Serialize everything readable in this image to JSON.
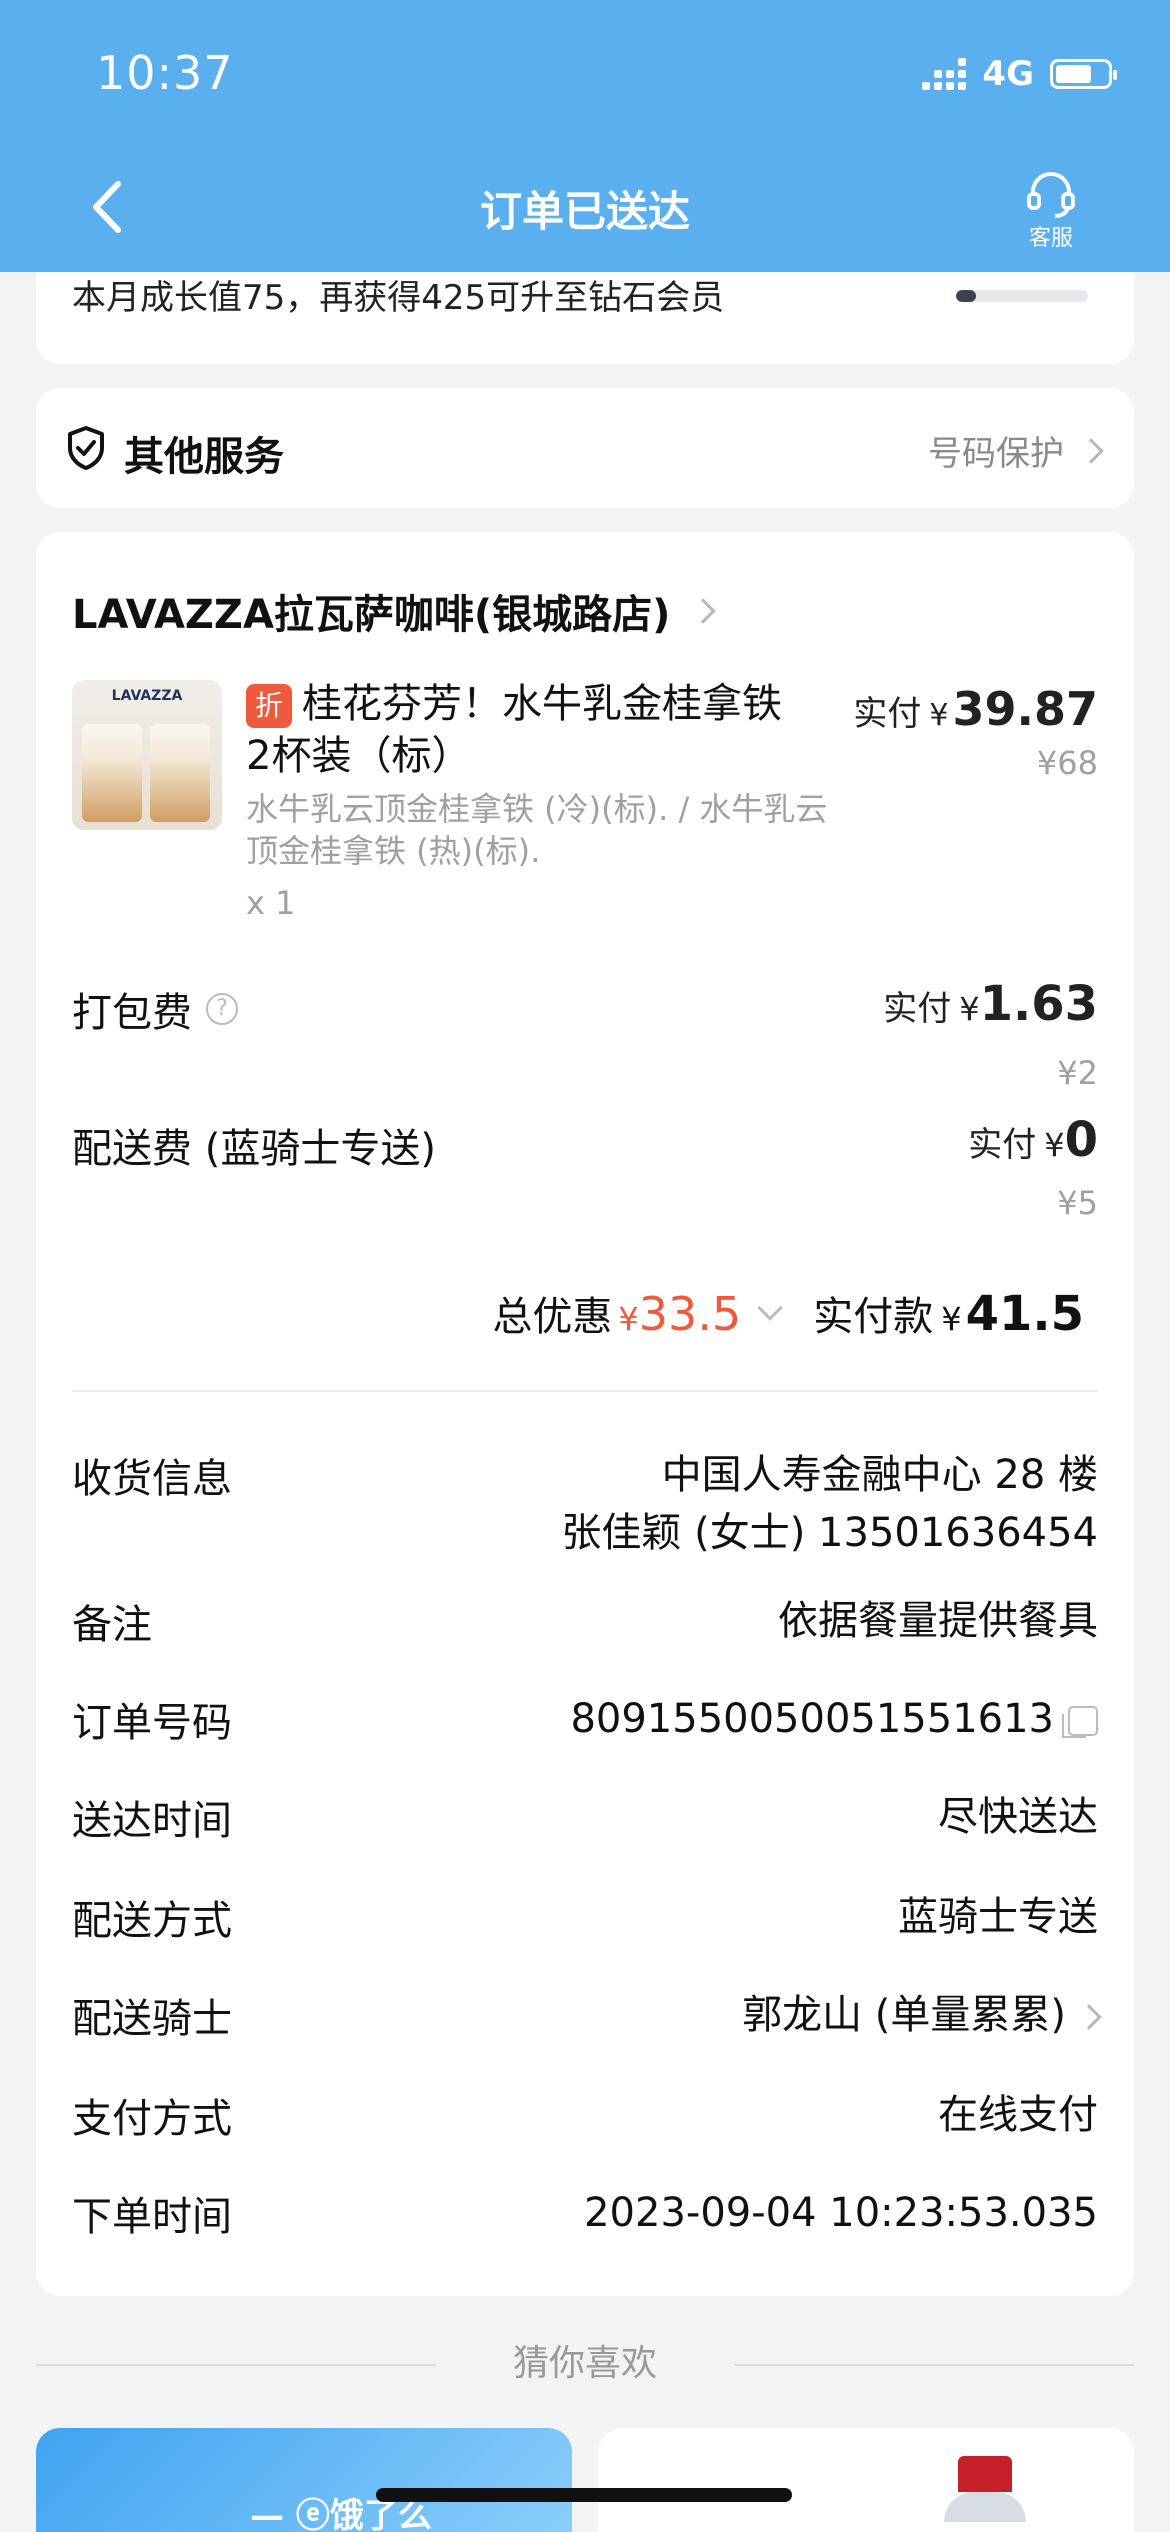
{
  "status_bar": {
    "time": "10:37",
    "network": "4G"
  },
  "header": {
    "title": "订单已送达",
    "service_label": "客服"
  },
  "growth": {
    "text": "本月成长值75，再获得425可升至钻石会员",
    "progress": 0.15
  },
  "services": {
    "title": "其他服务",
    "right_label": "号码保护"
  },
  "order": {
    "store_name": "LAVAZZA拉瓦萨咖啡(银城路店)",
    "product": {
      "image_brand": "LAVAZZA",
      "discount_tag": "折",
      "name_line1": "桂花芬芳！水牛乳金桂拿铁",
      "name_line2": "2杯装（标）",
      "spec": "水牛乳云顶金桂拿铁 (冷)(标). / 水牛乳云顶金桂拿铁 (热)(标).",
      "qty": "x 1",
      "paid_label": "实付",
      "yen": "¥",
      "paid_amount": "39.87",
      "original_price": "¥68"
    },
    "packing": {
      "label": "打包费",
      "help": "?",
      "paid_label": "实付",
      "yen": "¥",
      "paid_amount": "1.63",
      "original": "¥2"
    },
    "delivery_fee": {
      "label": "配送费 (蓝骑士专送)",
      "paid_label": "实付",
      "yen": "¥",
      "paid_amount": "0",
      "original": "¥5"
    },
    "totals": {
      "discount_label": "总优惠",
      "discount_yen": "¥",
      "discount_amount": "33.5",
      "paid_label": "实付款",
      "paid_yen": "¥",
      "paid_amount": "41.5"
    },
    "info": {
      "address_key": "收货信息",
      "address_line1": "中国人寿金融中心 28 楼",
      "address_line2": "张佳颖 (女士) 13501636454",
      "note_key": "备注",
      "note_val": "依据餐量提供餐具",
      "order_no_key": "订单号码",
      "order_no_val": "8091550050051551613",
      "arrival_key": "送达时间",
      "arrival_val": "尽快送达",
      "method_key": "配送方式",
      "method_val": "蓝骑士专送",
      "rider_key": "配送骑士",
      "rider_val": "郭龙山 (单量累累)",
      "payment_key": "支付方式",
      "payment_val": "在线支付",
      "time_key": "下单时间",
      "time_val": "2023-09-04 10:23:53.035"
    }
  },
  "recommend": {
    "title": "猜你喜欢",
    "left_logo": "饿了么"
  },
  "colors": {
    "header": "#5aafef",
    "accent_red": "#ef5a3c",
    "page_bg": "#f2f3f5"
  }
}
